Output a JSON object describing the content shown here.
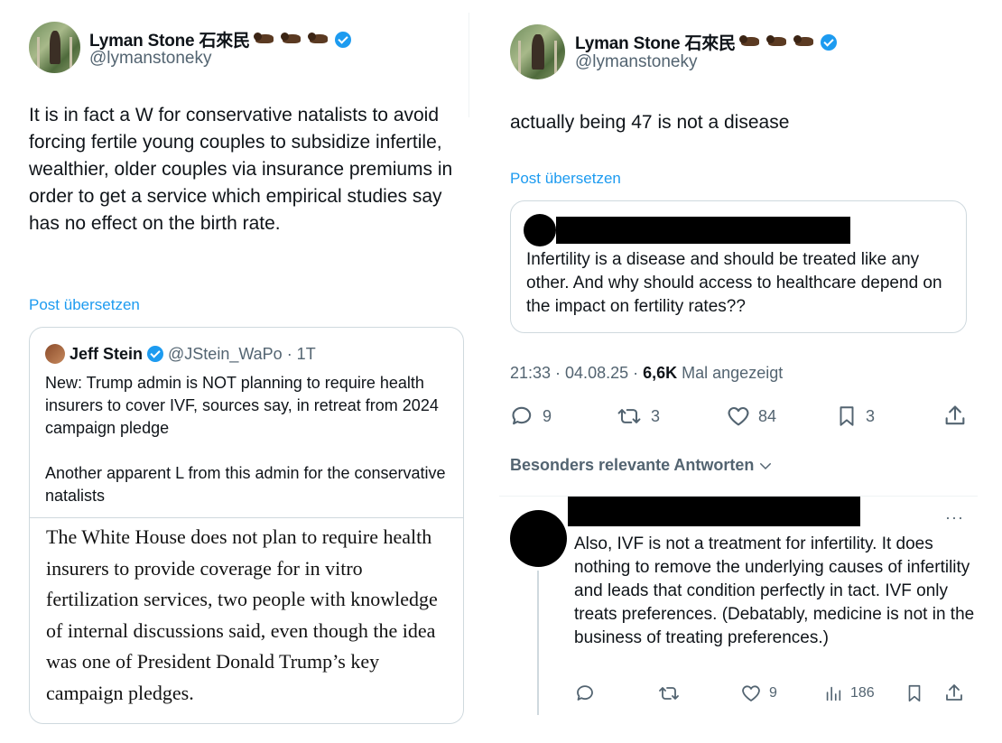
{
  "left_post": {
    "author_name": "Lyman Stone 石來民",
    "author_handle": "@lymanstoneky",
    "text": "It is in fact a W for conservative natalists to avoid forcing fertile young couples to subsidize infertile, wealthier, older couples via insurance premiums in order to get a service which empirical studies say has no effect on the birth rate.",
    "translate_label": "Post übersetzen",
    "quote": {
      "name": "Jeff Stein",
      "handle_time": "@JStein_WaPo · 1T",
      "text_1": "New: Trump admin is NOT planning to require health insurers to cover IVF, sources say, in retreat from 2024 campaign pledge",
      "text_2": "Another apparent L from this admin for the conservative natalists",
      "article_excerpt": "The White House does not plan to require health insurers to provide coverage for in vitro fertilization services, two people with knowledge of internal discussions said, even though the idea was one of President Donald Trump’s key campaign pledges."
    }
  },
  "right_post": {
    "author_name": "Lyman Stone 石來民",
    "author_handle": "@lymanstoneky",
    "text": "actually being 47 is not a disease",
    "translate_label": "Post übersetzen",
    "quote": {
      "text": "Infertility is a disease and should be treated like any other. And why should access to healthcare depend on the impact on fertility rates??"
    },
    "meta": {
      "time_date": "21:33 · 04.08.25 · ",
      "views": "6,6K",
      "views_label": " Mal angezeigt"
    },
    "actions": {
      "replies": "9",
      "reposts": "3",
      "likes": "84",
      "bookmarks": "3"
    },
    "replies_sort_label": "Besonders relevante Antworten",
    "reply": {
      "more": "···",
      "text": "Also, IVF is not a treatment for infertility. It does nothing to remove the underlying causes of infertility and leads that condition perfectly in tact. IVF only treats preferences. (Debatably, medicine is not in the business of treating preferences.)",
      "likes": "9",
      "views": "186"
    }
  },
  "colors": {
    "accent": "#1d9bf0",
    "muted": "#536471",
    "text": "#0f1419",
    "border": "#cfd9de"
  }
}
